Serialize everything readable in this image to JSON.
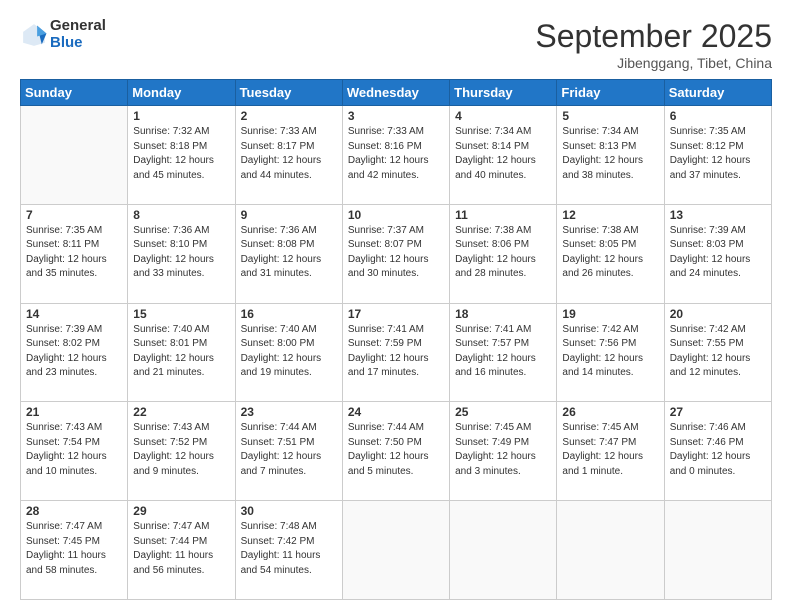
{
  "logo": {
    "general": "General",
    "blue": "Blue"
  },
  "header": {
    "title": "September 2025",
    "subtitle": "Jibenggang, Tibet, China"
  },
  "days_of_week": [
    "Sunday",
    "Monday",
    "Tuesday",
    "Wednesday",
    "Thursday",
    "Friday",
    "Saturday"
  ],
  "weeks": [
    [
      {
        "day": "",
        "info": ""
      },
      {
        "day": "1",
        "info": "Sunrise: 7:32 AM\nSunset: 8:18 PM\nDaylight: 12 hours\nand 45 minutes."
      },
      {
        "day": "2",
        "info": "Sunrise: 7:33 AM\nSunset: 8:17 PM\nDaylight: 12 hours\nand 44 minutes."
      },
      {
        "day": "3",
        "info": "Sunrise: 7:33 AM\nSunset: 8:16 PM\nDaylight: 12 hours\nand 42 minutes."
      },
      {
        "day": "4",
        "info": "Sunrise: 7:34 AM\nSunset: 8:14 PM\nDaylight: 12 hours\nand 40 minutes."
      },
      {
        "day": "5",
        "info": "Sunrise: 7:34 AM\nSunset: 8:13 PM\nDaylight: 12 hours\nand 38 minutes."
      },
      {
        "day": "6",
        "info": "Sunrise: 7:35 AM\nSunset: 8:12 PM\nDaylight: 12 hours\nand 37 minutes."
      }
    ],
    [
      {
        "day": "7",
        "info": "Sunrise: 7:35 AM\nSunset: 8:11 PM\nDaylight: 12 hours\nand 35 minutes."
      },
      {
        "day": "8",
        "info": "Sunrise: 7:36 AM\nSunset: 8:10 PM\nDaylight: 12 hours\nand 33 minutes."
      },
      {
        "day": "9",
        "info": "Sunrise: 7:36 AM\nSunset: 8:08 PM\nDaylight: 12 hours\nand 31 minutes."
      },
      {
        "day": "10",
        "info": "Sunrise: 7:37 AM\nSunset: 8:07 PM\nDaylight: 12 hours\nand 30 minutes."
      },
      {
        "day": "11",
        "info": "Sunrise: 7:38 AM\nSunset: 8:06 PM\nDaylight: 12 hours\nand 28 minutes."
      },
      {
        "day": "12",
        "info": "Sunrise: 7:38 AM\nSunset: 8:05 PM\nDaylight: 12 hours\nand 26 minutes."
      },
      {
        "day": "13",
        "info": "Sunrise: 7:39 AM\nSunset: 8:03 PM\nDaylight: 12 hours\nand 24 minutes."
      }
    ],
    [
      {
        "day": "14",
        "info": "Sunrise: 7:39 AM\nSunset: 8:02 PM\nDaylight: 12 hours\nand 23 minutes."
      },
      {
        "day": "15",
        "info": "Sunrise: 7:40 AM\nSunset: 8:01 PM\nDaylight: 12 hours\nand 21 minutes."
      },
      {
        "day": "16",
        "info": "Sunrise: 7:40 AM\nSunset: 8:00 PM\nDaylight: 12 hours\nand 19 minutes."
      },
      {
        "day": "17",
        "info": "Sunrise: 7:41 AM\nSunset: 7:59 PM\nDaylight: 12 hours\nand 17 minutes."
      },
      {
        "day": "18",
        "info": "Sunrise: 7:41 AM\nSunset: 7:57 PM\nDaylight: 12 hours\nand 16 minutes."
      },
      {
        "day": "19",
        "info": "Sunrise: 7:42 AM\nSunset: 7:56 PM\nDaylight: 12 hours\nand 14 minutes."
      },
      {
        "day": "20",
        "info": "Sunrise: 7:42 AM\nSunset: 7:55 PM\nDaylight: 12 hours\nand 12 minutes."
      }
    ],
    [
      {
        "day": "21",
        "info": "Sunrise: 7:43 AM\nSunset: 7:54 PM\nDaylight: 12 hours\nand 10 minutes."
      },
      {
        "day": "22",
        "info": "Sunrise: 7:43 AM\nSunset: 7:52 PM\nDaylight: 12 hours\nand 9 minutes."
      },
      {
        "day": "23",
        "info": "Sunrise: 7:44 AM\nSunset: 7:51 PM\nDaylight: 12 hours\nand 7 minutes."
      },
      {
        "day": "24",
        "info": "Sunrise: 7:44 AM\nSunset: 7:50 PM\nDaylight: 12 hours\nand 5 minutes."
      },
      {
        "day": "25",
        "info": "Sunrise: 7:45 AM\nSunset: 7:49 PM\nDaylight: 12 hours\nand 3 minutes."
      },
      {
        "day": "26",
        "info": "Sunrise: 7:45 AM\nSunset: 7:47 PM\nDaylight: 12 hours\nand 1 minute."
      },
      {
        "day": "27",
        "info": "Sunrise: 7:46 AM\nSunset: 7:46 PM\nDaylight: 12 hours\nand 0 minutes."
      }
    ],
    [
      {
        "day": "28",
        "info": "Sunrise: 7:47 AM\nSunset: 7:45 PM\nDaylight: 11 hours\nand 58 minutes."
      },
      {
        "day": "29",
        "info": "Sunrise: 7:47 AM\nSunset: 7:44 PM\nDaylight: 11 hours\nand 56 minutes."
      },
      {
        "day": "30",
        "info": "Sunrise: 7:48 AM\nSunset: 7:42 PM\nDaylight: 11 hours\nand 54 minutes."
      },
      {
        "day": "",
        "info": ""
      },
      {
        "day": "",
        "info": ""
      },
      {
        "day": "",
        "info": ""
      },
      {
        "day": "",
        "info": ""
      }
    ]
  ]
}
